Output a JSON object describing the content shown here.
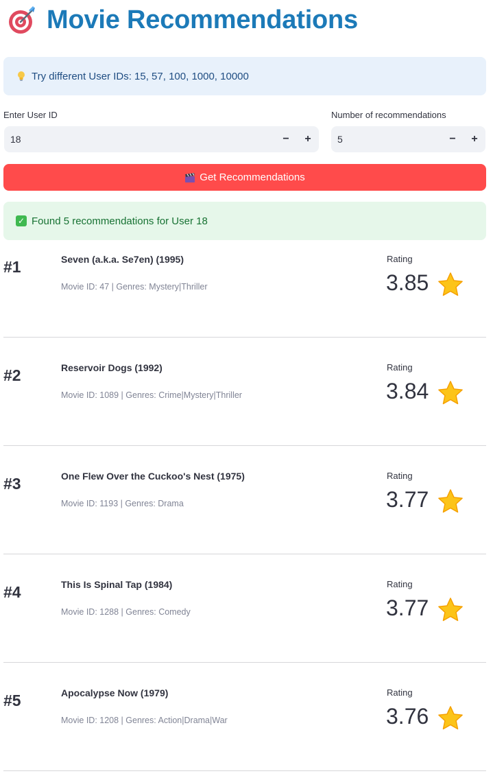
{
  "header": {
    "title": "Movie Recommendations",
    "icon": "target-dart-icon",
    "title_color": "#1c7ab8"
  },
  "info": {
    "icon": "lightbulb-icon",
    "text": "Try different User IDs: 15, 57, 100, 1000, 10000"
  },
  "user_id": {
    "label": "Enter User ID",
    "value": "18",
    "decrement": "−",
    "increment": "+"
  },
  "num_recs": {
    "label": "Number of recommendations",
    "value": "5",
    "decrement": "−",
    "increment": "+"
  },
  "get_button": {
    "icon": "clapperboard-icon",
    "label": "Get Recommendations",
    "color": "#ff4b4b"
  },
  "success": {
    "icon": "check-icon",
    "text": "Found 5 recommendations for User 18"
  },
  "rating_label": "Rating",
  "recommendations": [
    {
      "rank": "#1",
      "title": "Seven (a.k.a. Se7en) (1995)",
      "meta": "Movie ID: 47 | Genres: Mystery|Thriller",
      "rating": "3.85"
    },
    {
      "rank": "#2",
      "title": "Reservoir Dogs (1992)",
      "meta": "Movie ID: 1089 | Genres: Crime|Mystery|Thriller",
      "rating": "3.84"
    },
    {
      "rank": "#3",
      "title": "One Flew Over the Cuckoo's Nest (1975)",
      "meta": "Movie ID: 1193 | Genres: Drama",
      "rating": "3.77"
    },
    {
      "rank": "#4",
      "title": "This Is Spinal Tap (1984)",
      "meta": "Movie ID: 1288 | Genres: Comedy",
      "rating": "3.77"
    },
    {
      "rank": "#5",
      "title": "Apocalypse Now (1979)",
      "meta": "Movie ID: 1208 | Genres: Action|Drama|War",
      "rating": "3.76"
    }
  ]
}
